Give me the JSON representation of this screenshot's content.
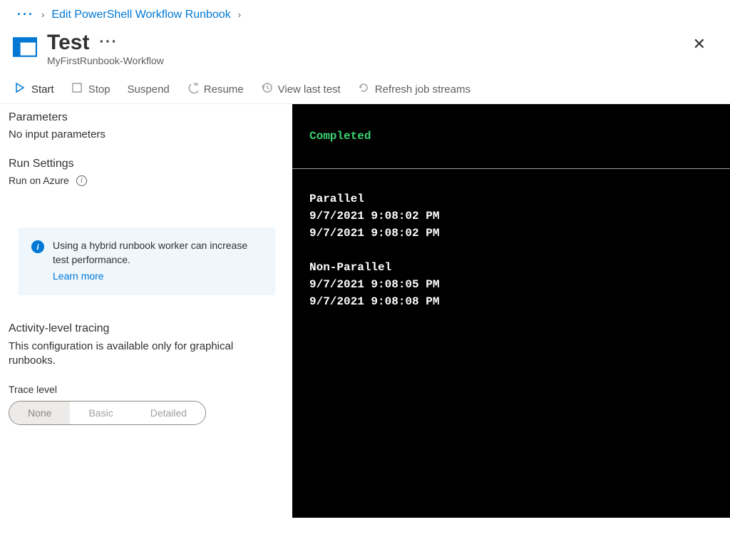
{
  "breadcrumb": {
    "dots": "···",
    "link": "Edit PowerShell Workflow Runbook",
    "chev": "›"
  },
  "header": {
    "title": "Test",
    "menu_dots": "···",
    "subtitle": "MyFirstRunbook-Workflow",
    "close": "✕"
  },
  "toolbar": {
    "start": "Start",
    "stop": "Stop",
    "suspend": "Suspend",
    "resume": "Resume",
    "view_last": "View last test",
    "refresh": "Refresh job streams"
  },
  "left": {
    "parameters_h": "Parameters",
    "parameters_txt": "No input parameters",
    "run_settings_h": "Run Settings",
    "run_on": "Run on Azure",
    "info_text": "Using a hybrid runbook worker can increase test performance.",
    "info_link": "Learn more",
    "tracing_h": "Activity-level tracing",
    "tracing_desc": "This configuration is available only for graphical runbooks.",
    "trace_label": "Trace level",
    "trace_opts": {
      "none": "None",
      "basic": "Basic",
      "detailed": "Detailed"
    }
  },
  "terminal": {
    "status": "Completed",
    "output": "Parallel\n9/7/2021 9:08:02 PM\n9/7/2021 9:08:02 PM\n\nNon-Parallel\n9/7/2021 9:08:05 PM\n9/7/2021 9:08:08 PM"
  },
  "colors": {
    "link": "#0078d4",
    "term_green": "#3bd16f"
  }
}
